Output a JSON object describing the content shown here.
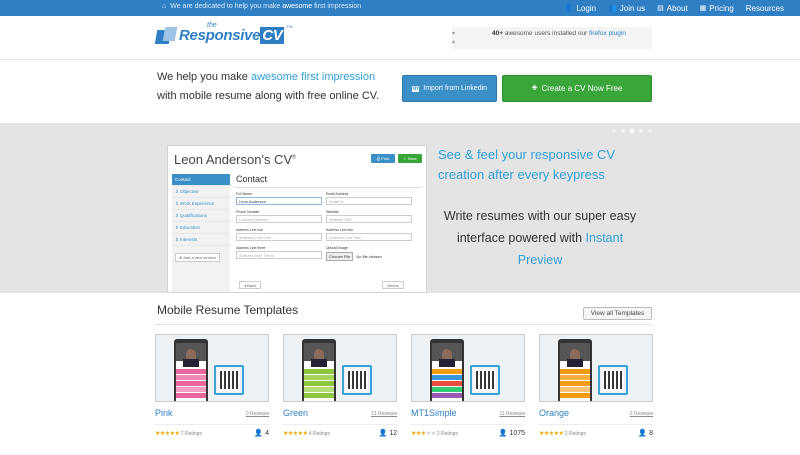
{
  "topbar": {
    "tagline_pre": "We are dedicated to help you make",
    "tagline_bold": "awesome",
    "tagline_post": "first impression",
    "nav": [
      {
        "label": "Login",
        "icon": "user-icon"
      },
      {
        "label": "Join us",
        "icon": "users-icon"
      },
      {
        "label": "About",
        "icon": "card-icon"
      },
      {
        "label": "Pricing",
        "icon": "grid-icon"
      },
      {
        "label": "Resources",
        "icon": ""
      }
    ]
  },
  "header": {
    "logo_the": "the",
    "logo_name": "Responsive",
    "logo_cv": "CV",
    "logo_tm": "TM",
    "users_count": "40+",
    "users_text": "awesome users installed our",
    "users_link": "firefox plugin"
  },
  "promo": {
    "line1_pre": "We help you make",
    "line1_highlight": "awesome first impression",
    "line2": "with mobile resume along with free online CV.",
    "linkedin_icon": "in",
    "linkedin_label": "Import from Linkedin",
    "create_label": "Create a CV Now Free"
  },
  "hero": {
    "mock_title": "Leon Anderson's CV",
    "mock_title_sup": "®",
    "mock_print": "Print",
    "mock_save": "Save",
    "sidebar": [
      {
        "label": "Contact",
        "active": true
      },
      {
        "label": "Objective",
        "active": false
      },
      {
        "label": "Work Experience",
        "active": false
      },
      {
        "label": "Qualifications",
        "active": false
      },
      {
        "label": "Education",
        "active": false
      },
      {
        "label": "Interests",
        "active": false
      }
    ],
    "add_section": "Add a new section",
    "section_title": "Contact",
    "fields": {
      "fullname_label": "Full Name",
      "fullname_value": "Leon Anderson",
      "email_label": "Email Address",
      "email_ph": "Email Id",
      "phone_label": "Phone Number",
      "phone_ph": "Contact Number",
      "website_label": "Website",
      "website_ph": "Website URL",
      "addr1_label": "Address Line one",
      "addr1_ph": "Address Line One",
      "addr2_label": "Address Line two",
      "addr2_ph": "Address Line Two",
      "addr3_label": "Address Line three",
      "addr3_ph": "Address Line Three",
      "upload_label": "Upload Image",
      "choose_file": "Choose File",
      "no_file": "No file chosen"
    },
    "back": "Back",
    "next": "Next",
    "see_feel": "See & feel your responsive CV creation after every keypress",
    "write_pre": "Write resumes with our super easy interface powered with",
    "write_highlight": "Instant Preview"
  },
  "templates": {
    "title": "Mobile Resume Templates",
    "view_all": "View all Templates",
    "cards": [
      {
        "name": "Pink",
        "reviews": "0 Reviews",
        "ratings": "7 Ratings",
        "downloads": "4",
        "stars": 5,
        "bars": [
          "#e8669b",
          "#f08ab4",
          "#e8669b",
          "#f49dc0",
          "#e8669b"
        ]
      },
      {
        "name": "Green",
        "reviews": "21 Reviews",
        "ratings": "4 Ratings",
        "downloads": "12",
        "stars": 5,
        "bars": [
          "#8dc63f",
          "#a4d65e",
          "#8dc63f",
          "#b5de78",
          "#8dc63f"
        ]
      },
      {
        "name": "MT1Simple",
        "reviews": "11 Reviews",
        "ratings": "2 Ratings",
        "downloads": "1075",
        "stars": 3,
        "bars": [
          "#f39c12",
          "#3498db",
          "#e74c3c",
          "#2ecc71",
          "#9b59b6"
        ]
      },
      {
        "name": "Orange",
        "reviews": "2 Reviews",
        "ratings": "2 Ratings",
        "downloads": "8",
        "stars": 5,
        "bars": [
          "#f39c12",
          "#f5b041",
          "#f39c12",
          "#f8c471",
          "#f39c12"
        ]
      }
    ]
  },
  "colors": {
    "brand": "#2f7fc4",
    "accent": "#2f9fd8",
    "green": "#3aa63a"
  }
}
